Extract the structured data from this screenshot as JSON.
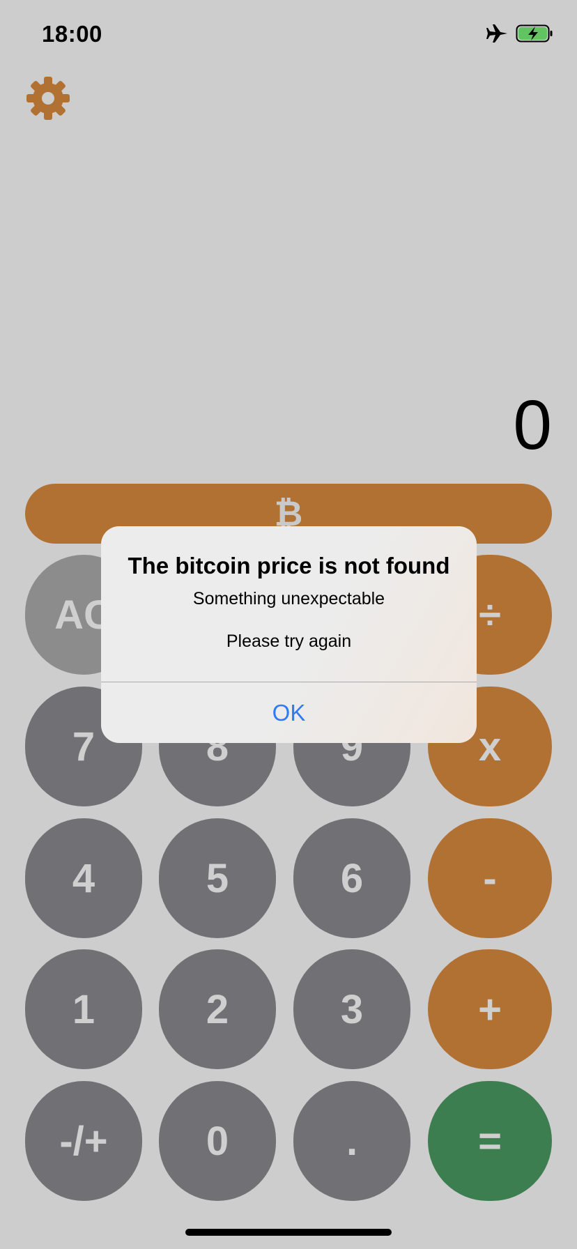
{
  "status_bar": {
    "time": "18:00"
  },
  "display": {
    "value": "0"
  },
  "bitcoin_bar": {
    "symbol": "₿"
  },
  "keys": {
    "clear": "AC",
    "divide": "÷",
    "seven": "7",
    "eight": "8",
    "nine": "9",
    "multiply": "x",
    "four": "4",
    "five": "5",
    "six": "6",
    "minus": "-",
    "one": "1",
    "two": "2",
    "three": "3",
    "plus": "+",
    "sign": "-/+",
    "zero": "0",
    "dot": ".",
    "equals": "="
  },
  "alert": {
    "title": "The bitcoin price is not found",
    "message_line1": "Something unexpectable",
    "message_line2": "Please try again",
    "ok_label": "OK"
  },
  "colors": {
    "accent_orange": "#b17132",
    "equals_green": "#3c7e50",
    "number_key": "#717175",
    "alert_button_blue": "#2f7af5"
  }
}
